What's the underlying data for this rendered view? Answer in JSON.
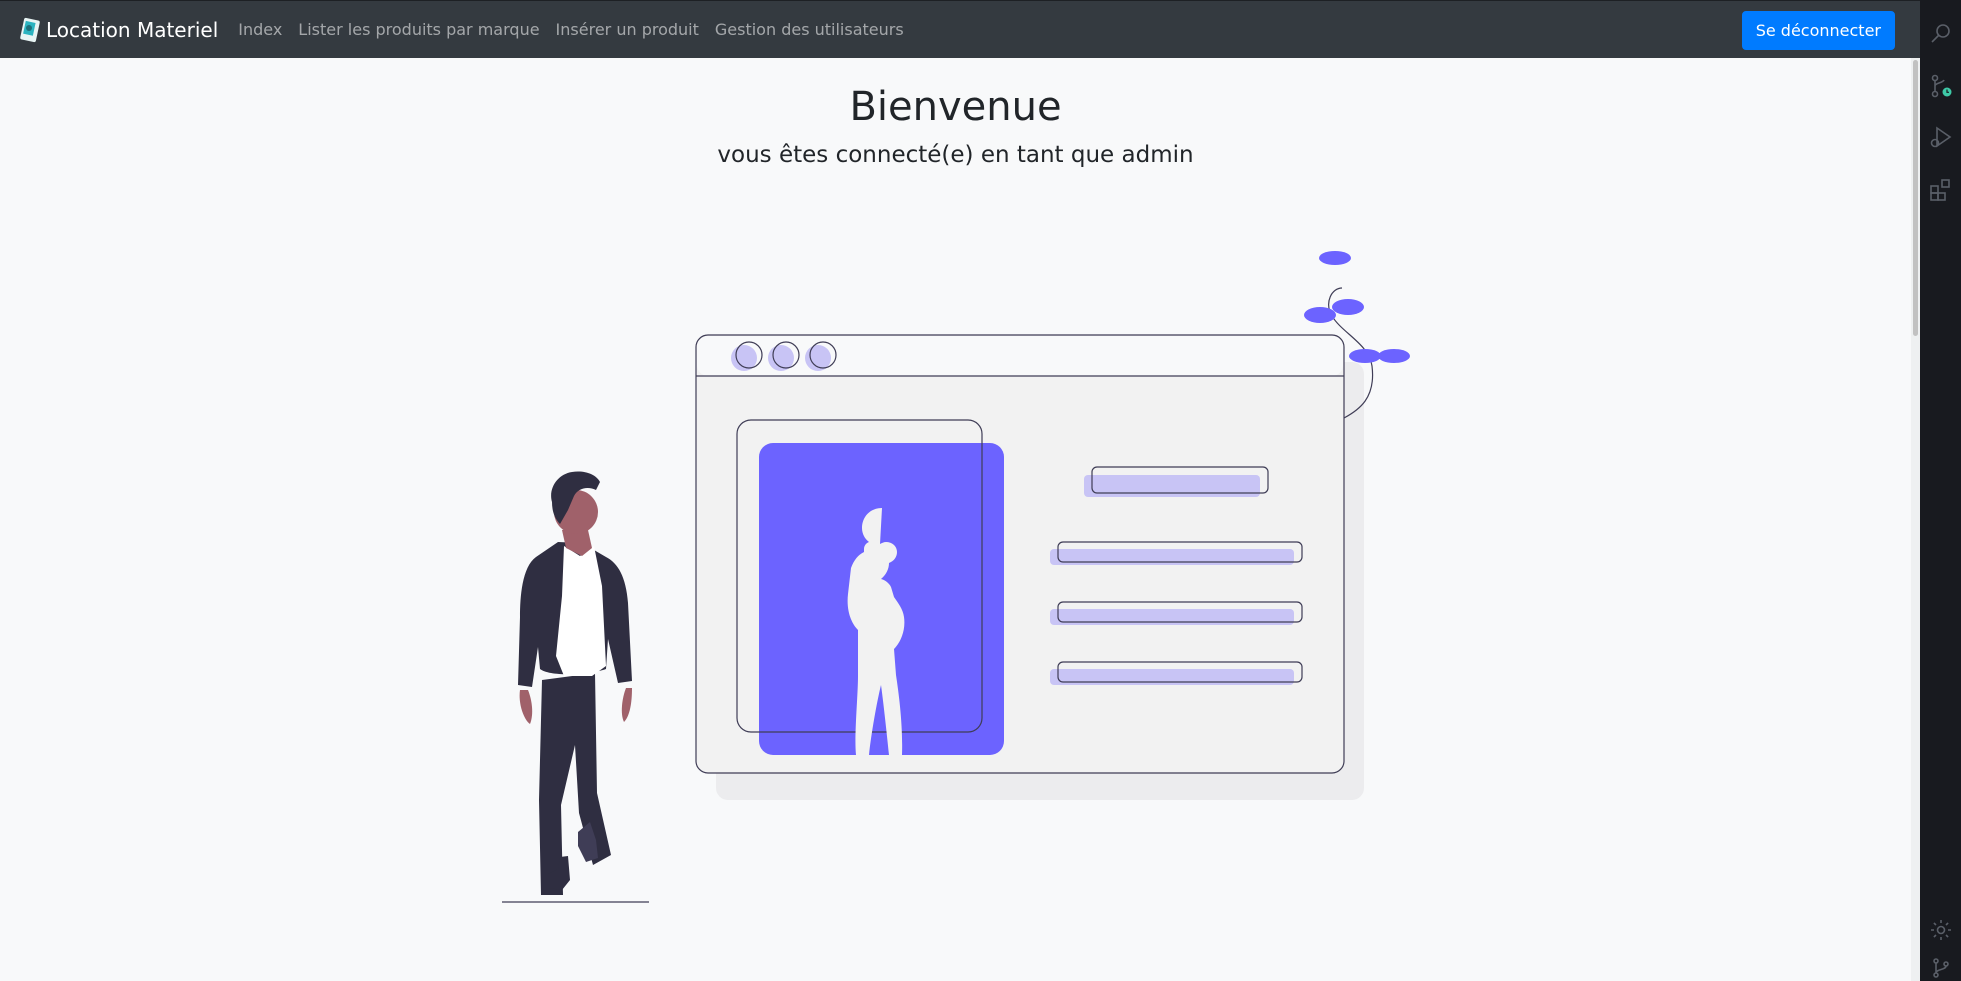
{
  "navbar": {
    "brand": "Location Materiel",
    "links": [
      "Index",
      "Lister les produits par marque",
      "Insérer un produit",
      "Gestion des utilisateurs"
    ],
    "logout_label": "Se déconnecter"
  },
  "main": {
    "title": "Bienvenue",
    "subtitle": "vous êtes connecté(e) en tant que admin"
  },
  "colors": {
    "navbar_bg": "#343a40",
    "accent": "#6c63ff",
    "primary_button": "#007bff"
  },
  "illustration": {
    "name": "profile-page-illustration",
    "icons": [
      "search-icon",
      "source-control-icon",
      "run-debug-icon",
      "extensions-icon",
      "settings-gear-icon",
      "branch-icon"
    ]
  }
}
